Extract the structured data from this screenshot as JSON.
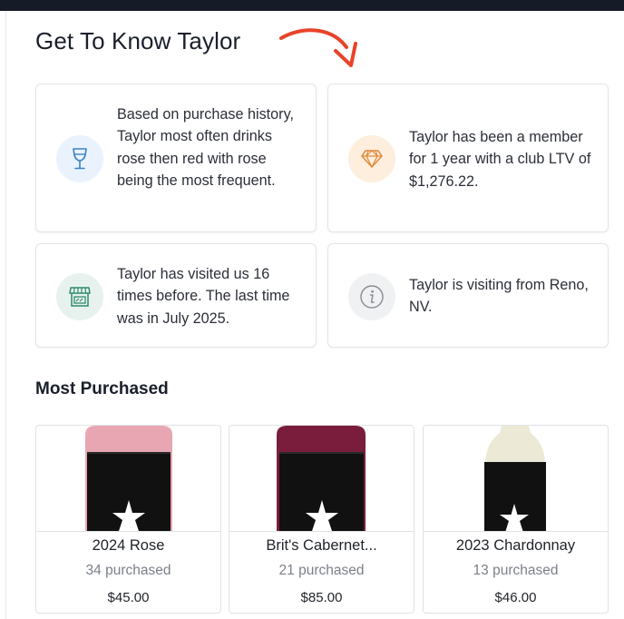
{
  "header": {
    "title": "Get To Know Taylor"
  },
  "insights": [
    {
      "icon": "wine-glass-icon",
      "text": "Based on purchase history, Taylor most often drinks rose then red with rose being the most frequent."
    },
    {
      "icon": "diamond-icon",
      "text": "Taylor has been a member for 1 year with a club LTV of $1,276.22."
    },
    {
      "icon": "storefront-icon",
      "text": "Taylor has visited us 16 times before. The last time was in July 2025."
    },
    {
      "icon": "info-icon",
      "text": "Taylor is visiting from Reno, NV."
    }
  ],
  "most_purchased": {
    "title": "Most Purchased",
    "products": [
      {
        "name": "2024 Rose",
        "count": "34 purchased",
        "price": "$45.00",
        "bottle_color": "#e8a6b2"
      },
      {
        "name": "Brit's Cabernet...",
        "count": "21 purchased",
        "price": "$85.00",
        "bottle_color": "#7a1d3c"
      },
      {
        "name": "2023 Chardonnay",
        "count": "13 purchased",
        "price": "$46.00",
        "bottle_color": "#ecead7"
      }
    ]
  },
  "colors": {
    "wine_icon_bg": "#eaf3fd",
    "wine_icon_fg": "#3b82c4",
    "diamond_icon_bg": "#fdeedd",
    "diamond_icon_fg": "#e08a3c",
    "store_icon_bg": "#e7f2ee",
    "store_icon_fg": "#2e8b6a",
    "info_icon_bg": "#f0f1f3",
    "info_icon_fg": "#8b9099",
    "arrow": "#e8432a"
  }
}
